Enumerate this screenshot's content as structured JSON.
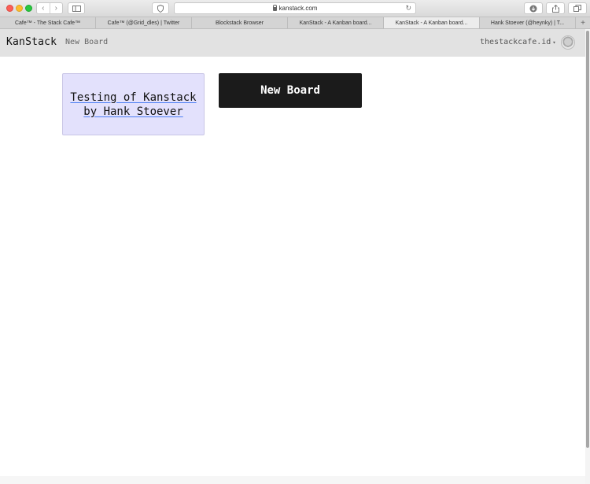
{
  "browser": {
    "url": "kanstack.com",
    "tabs": [
      {
        "label": "Cafe™ - The Stack Cafe™",
        "active": false
      },
      {
        "label": "Cafe™ (@Grid_dles) | Twitter",
        "active": false
      },
      {
        "label": "Blockstack Browser",
        "active": false
      },
      {
        "label": "KanStack - A Kanban board...",
        "active": false
      },
      {
        "label": "KanStack - A Kanban board...",
        "active": true
      },
      {
        "label": "Hank Stoever (@heynky) | T...",
        "active": false
      }
    ],
    "icons": {
      "back": "chevron-left-icon",
      "forward": "chevron-right-icon",
      "sidebar": "sidebar-icon",
      "privacy": "privacy-report-icon",
      "lock": "lock-icon",
      "reload": "reload-icon",
      "download": "download-icon",
      "share": "share-icon",
      "tabs": "tab-overview-icon",
      "new_tab": "plus-icon"
    }
  },
  "app": {
    "brand": "KanStack",
    "nav_new_board": "New Board",
    "user": "thestackcafe.id",
    "avatar_icon": "avatar-icon"
  },
  "boards": [
    {
      "title": "Testing of Kanstack by Hank Stoever"
    }
  ],
  "new_board_button": "New Board",
  "colors": {
    "board_card_bg": "#e3e1fc",
    "new_board_bg": "#1b1b1b",
    "header_bg": "#e2e2e2",
    "link_underline": "#4a7ef2"
  }
}
